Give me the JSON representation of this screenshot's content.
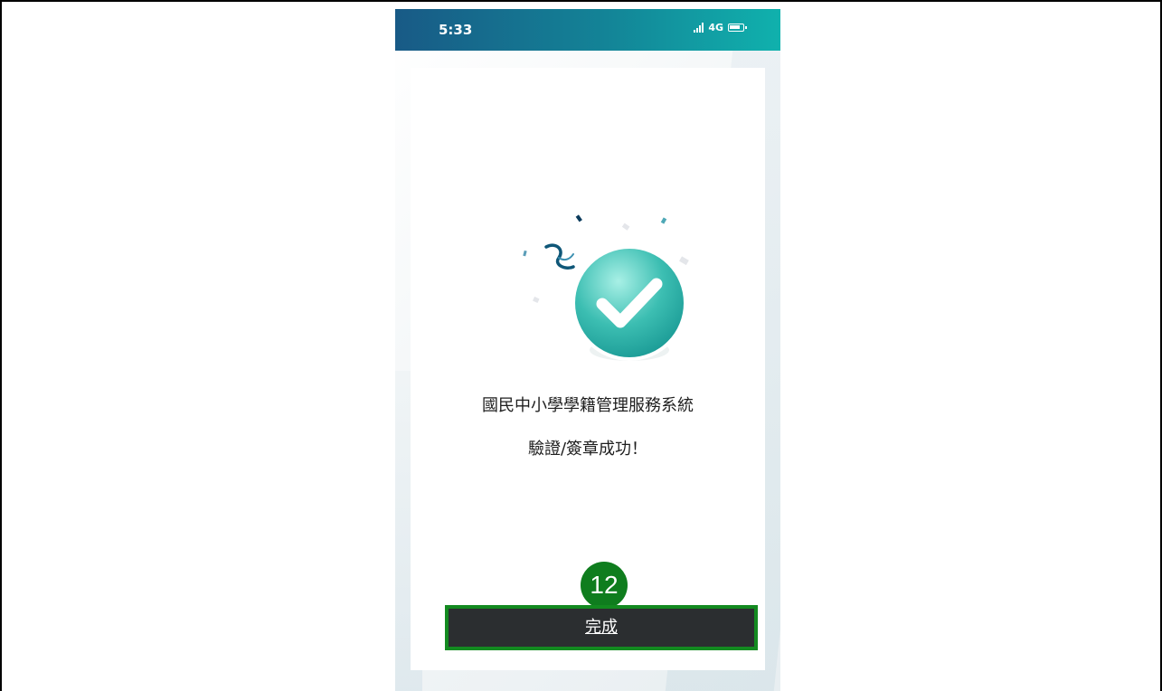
{
  "status_bar": {
    "time": "5:33",
    "network": "4G"
  },
  "message": {
    "line1": "國民中小學學籍管理服務系統",
    "line2": "驗證/簽章成功！"
  },
  "annotation": {
    "step_number": "12"
  },
  "action": {
    "done_label": "完成"
  },
  "colors": {
    "status_bar_start": "#185a86",
    "status_bar_end": "#10b1ad",
    "success_circle": "#2fb3a9",
    "annotation_green": "#0f7d1e",
    "button_background": "#2b2e30"
  },
  "icons": {
    "success": "checkmark-icon",
    "signal": "signal-icon",
    "battery": "battery-icon"
  }
}
